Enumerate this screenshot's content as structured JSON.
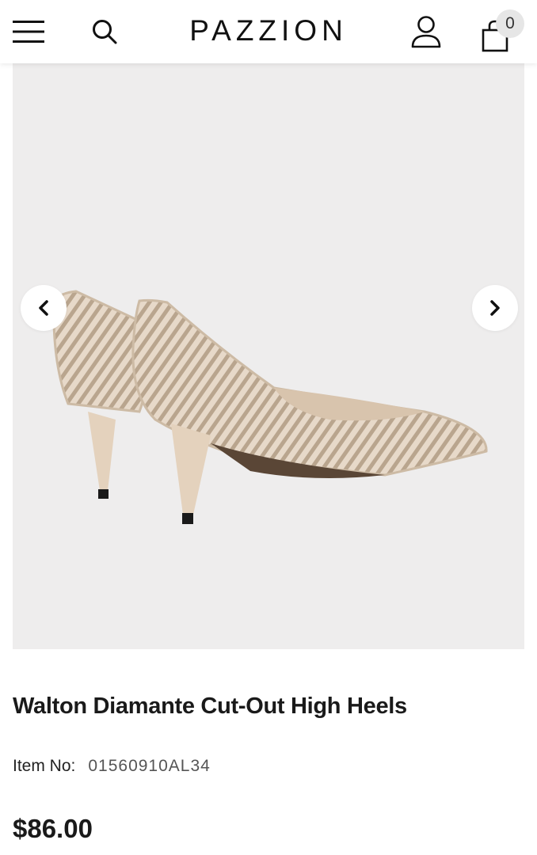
{
  "header": {
    "logo": "PAZZION",
    "cart_count": "0",
    "icons": [
      "hamburger-menu-icon",
      "search-icon",
      "user-icon",
      "shopping-bag-icon"
    ]
  },
  "gallery": {
    "image": "beige pointed kitten-heel pumps with diamante geometric cut-out pattern",
    "prev_icon": "chevron-left-icon",
    "next_icon": "chevron-right-icon"
  },
  "product": {
    "title": "Walton Diamante Cut-Out High Heels",
    "item_no_label": "Item No:",
    "item_no_value": "01560910AL34",
    "price": "$86.00"
  },
  "colors": {
    "header_bg": "#ffffff",
    "gallery_bg": "#eeeded",
    "text": "#1a1a1a",
    "shoe": "#e6d8c8"
  }
}
